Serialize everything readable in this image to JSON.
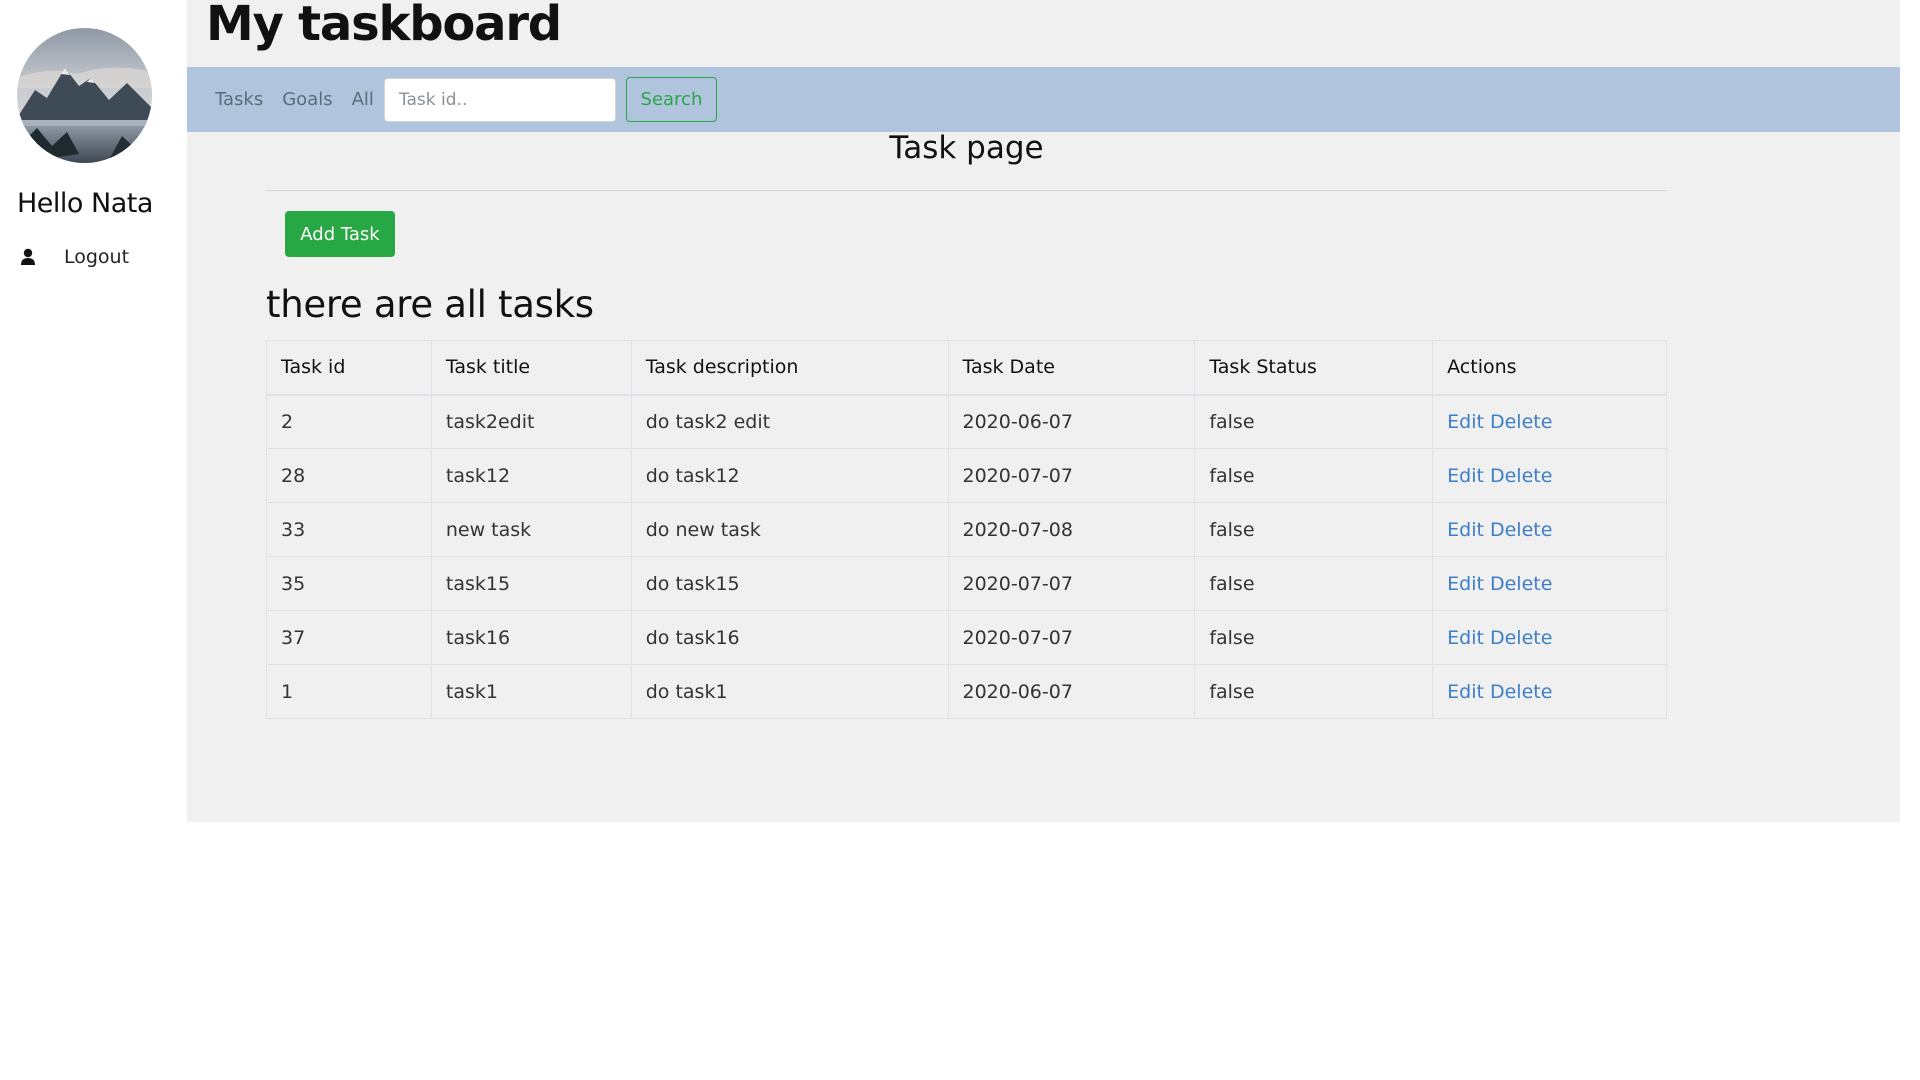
{
  "sidebar": {
    "greeting": "Hello Nata",
    "logout_label": "Logout",
    "logout_icon": "user-icon"
  },
  "header": {
    "title": "My taskboard"
  },
  "navbar": {
    "links": [
      "Tasks",
      "Goals",
      "All"
    ],
    "search": {
      "placeholder": "Task id..",
      "value": "",
      "button_label": "Search"
    },
    "background_color": "#b0c4de"
  },
  "main": {
    "heading": "Task page",
    "add_button_label": "Add Task",
    "list_heading": "there are all tasks"
  },
  "table": {
    "headers": [
      "Task id",
      "Task title",
      "Task description",
      "Task Date",
      "Task Status",
      "Actions"
    ],
    "rows": [
      {
        "id": "2",
        "title": "task2edit",
        "description": "do task2 edit",
        "date": "2020-06-07",
        "status": "false"
      },
      {
        "id": "28",
        "title": "task12",
        "description": "do task12",
        "date": "2020-07-07",
        "status": "false"
      },
      {
        "id": "33",
        "title": "new task",
        "description": "do new task",
        "date": "2020-07-08",
        "status": "false"
      },
      {
        "id": "35",
        "title": "task15",
        "description": "do task15",
        "date": "2020-07-07",
        "status": "false"
      },
      {
        "id": "37",
        "title": "task16",
        "description": "do task16",
        "date": "2020-07-07",
        "status": "false"
      },
      {
        "id": "1",
        "title": "task1",
        "description": "do task1",
        "date": "2020-06-07",
        "status": "false"
      }
    ],
    "edit_label": "Edit",
    "delete_label": "Delete"
  },
  "colors": {
    "accent_green": "#28a745",
    "link_blue": "#3d7ec8",
    "main_background": "#f0f0f0"
  }
}
